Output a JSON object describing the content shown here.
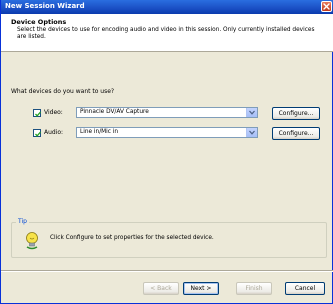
{
  "window": {
    "title": "New Session Wizard"
  },
  "header": {
    "title": "Device Options",
    "description": "Select the devices to use for encoding audio and video in this session. Only currently installed devices are listed."
  },
  "question": "What devices do you want to use?",
  "devices": [
    {
      "label": "Video:",
      "checked": true,
      "selected": "Pinnacle DV/AV Capture",
      "configure_label": "Configure..."
    },
    {
      "label": "Audio:",
      "checked": true,
      "selected": "Line in/Mic in",
      "configure_label": "Configure..."
    }
  ],
  "tip": {
    "label": "Tip",
    "text": "Click Configure to set properties for the selected device."
  },
  "footer": {
    "back": "< Back",
    "next": "Next >",
    "finish": "Finish",
    "cancel": "Cancel"
  },
  "colors": {
    "titlebar": "#1A4FC4",
    "dialog_bg": "#ECE9D8",
    "accent": "#0046D5"
  },
  "icons": {
    "close": "close-icon",
    "tip": "tip-light-bulb-icon",
    "check": "checkmark-icon",
    "dropdown": "chevron-down-icon"
  }
}
